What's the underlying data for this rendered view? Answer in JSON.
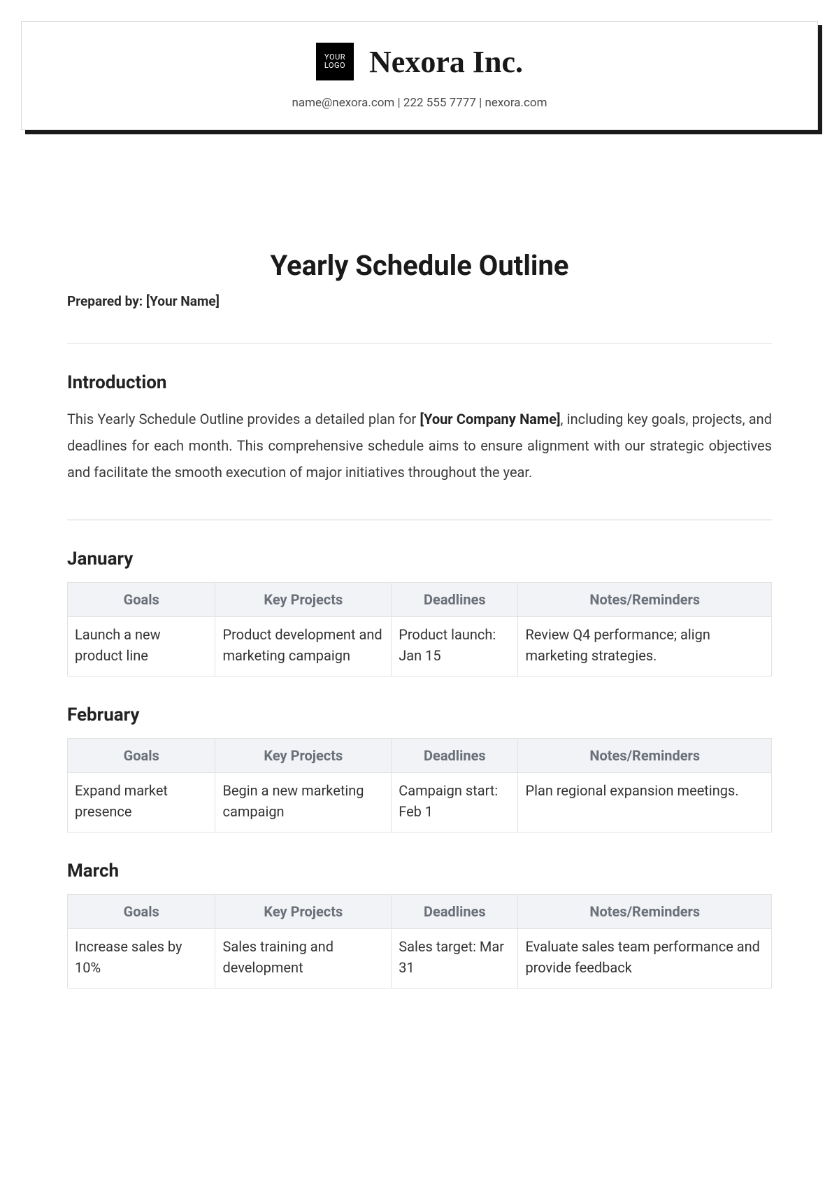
{
  "header": {
    "logo_line1": "YOUR",
    "logo_line2": "LOGO",
    "company_name": "Nexora Inc.",
    "contact": "name@nexora.com | 222 555 7777 | nexora.com"
  },
  "document": {
    "title": "Yearly Schedule Outline",
    "prepared_by_label": "Prepared by: [Your Name]"
  },
  "introduction": {
    "heading": "Introduction",
    "text_before": "This Yearly Schedule Outline provides a detailed plan for ",
    "bold": "[Your Company Name]",
    "text_after": ", including key goals, projects, and deadlines for each month. This comprehensive schedule aims to ensure alignment with our strategic objectives and facilitate the smooth execution of major initiatives throughout the year."
  },
  "table_headers": {
    "goals": "Goals",
    "projects": "Key Projects",
    "deadlines": "Deadlines",
    "notes": "Notes/Reminders"
  },
  "months": [
    {
      "name": "January",
      "goals": "Launch a new product line",
      "projects": "Product development and marketing campaign",
      "deadlines": "Product launch: Jan 15",
      "notes": "Review Q4 performance; align marketing strategies."
    },
    {
      "name": "February",
      "goals": "Expand market presence",
      "projects": "Begin a new marketing campaign",
      "deadlines": "Campaign start: Feb 1",
      "notes": "Plan regional expansion meetings."
    },
    {
      "name": "March",
      "goals": "Increase sales by 10%",
      "projects": "Sales training and development",
      "deadlines": "Sales target: Mar 31",
      "notes": "Evaluate sales team performance and provide feedback"
    }
  ]
}
